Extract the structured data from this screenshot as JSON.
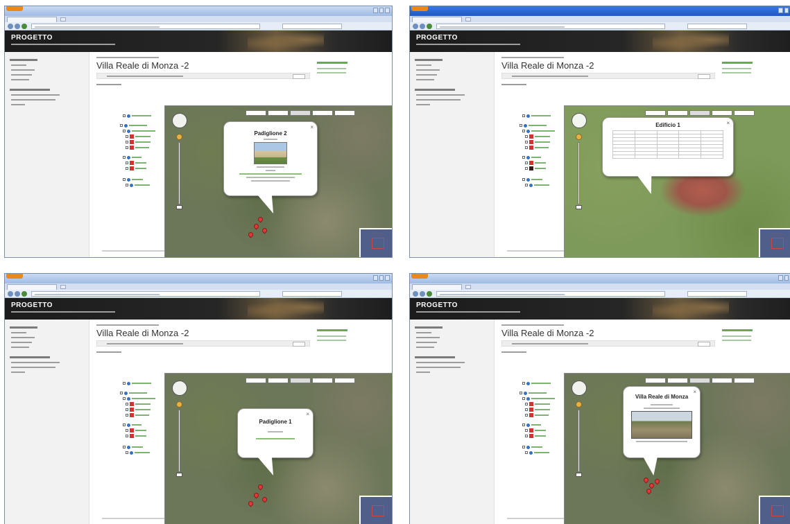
{
  "site": {
    "title": "PROGETTO"
  },
  "page": {
    "title": "Villa Reale di Monza -2"
  },
  "panels": [
    {
      "popup": {
        "title": "Padiglione 2"
      }
    },
    {
      "popup": {
        "title": "Edificio 1"
      }
    },
    {
      "popup": {
        "title": "Padiglione 1"
      }
    },
    {
      "popup": {
        "title": "Villa Reale di Monza"
      }
    }
  ],
  "colors": {
    "header": "#1c1c1c",
    "accent_green": "#6aa84f",
    "pin_red": "#e03a3a",
    "titlebar_active": "#1f57c6"
  },
  "icons": [
    "firefox-menu-icon",
    "pan-control-icon",
    "zoom-slider-icon",
    "close-icon",
    "map-pin-icon"
  ]
}
